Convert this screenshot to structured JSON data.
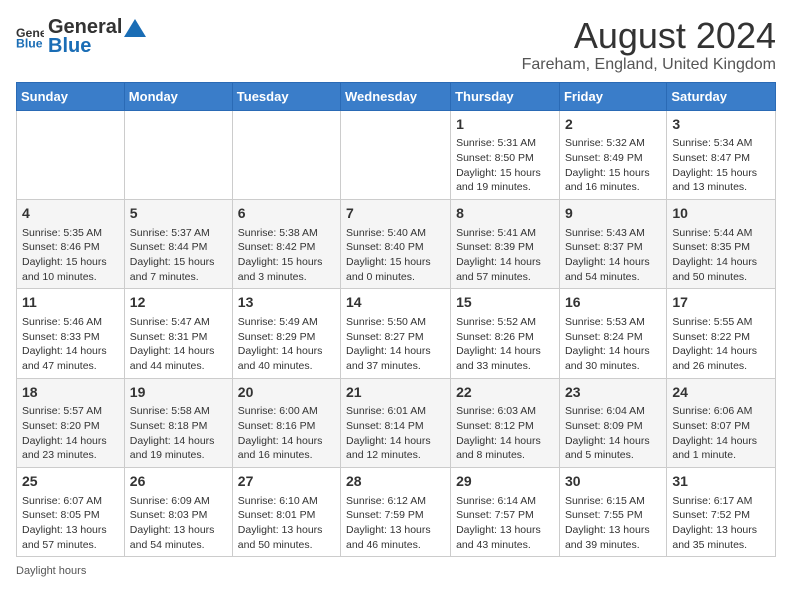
{
  "header": {
    "logo_general": "General",
    "logo_blue": "Blue",
    "title": "August 2024",
    "subtitle": "Fareham, England, United Kingdom"
  },
  "columns": [
    "Sunday",
    "Monday",
    "Tuesday",
    "Wednesday",
    "Thursday",
    "Friday",
    "Saturday"
  ],
  "weeks": [
    [
      {
        "day": "",
        "info": ""
      },
      {
        "day": "",
        "info": ""
      },
      {
        "day": "",
        "info": ""
      },
      {
        "day": "",
        "info": ""
      },
      {
        "day": "1",
        "info": "Sunrise: 5:31 AM\nSunset: 8:50 PM\nDaylight: 15 hours and 19 minutes."
      },
      {
        "day": "2",
        "info": "Sunrise: 5:32 AM\nSunset: 8:49 PM\nDaylight: 15 hours and 16 minutes."
      },
      {
        "day": "3",
        "info": "Sunrise: 5:34 AM\nSunset: 8:47 PM\nDaylight: 15 hours and 13 minutes."
      }
    ],
    [
      {
        "day": "4",
        "info": "Sunrise: 5:35 AM\nSunset: 8:46 PM\nDaylight: 15 hours and 10 minutes."
      },
      {
        "day": "5",
        "info": "Sunrise: 5:37 AM\nSunset: 8:44 PM\nDaylight: 15 hours and 7 minutes."
      },
      {
        "day": "6",
        "info": "Sunrise: 5:38 AM\nSunset: 8:42 PM\nDaylight: 15 hours and 3 minutes."
      },
      {
        "day": "7",
        "info": "Sunrise: 5:40 AM\nSunset: 8:40 PM\nDaylight: 15 hours and 0 minutes."
      },
      {
        "day": "8",
        "info": "Sunrise: 5:41 AM\nSunset: 8:39 PM\nDaylight: 14 hours and 57 minutes."
      },
      {
        "day": "9",
        "info": "Sunrise: 5:43 AM\nSunset: 8:37 PM\nDaylight: 14 hours and 54 minutes."
      },
      {
        "day": "10",
        "info": "Sunrise: 5:44 AM\nSunset: 8:35 PM\nDaylight: 14 hours and 50 minutes."
      }
    ],
    [
      {
        "day": "11",
        "info": "Sunrise: 5:46 AM\nSunset: 8:33 PM\nDaylight: 14 hours and 47 minutes."
      },
      {
        "day": "12",
        "info": "Sunrise: 5:47 AM\nSunset: 8:31 PM\nDaylight: 14 hours and 44 minutes."
      },
      {
        "day": "13",
        "info": "Sunrise: 5:49 AM\nSunset: 8:29 PM\nDaylight: 14 hours and 40 minutes."
      },
      {
        "day": "14",
        "info": "Sunrise: 5:50 AM\nSunset: 8:27 PM\nDaylight: 14 hours and 37 minutes."
      },
      {
        "day": "15",
        "info": "Sunrise: 5:52 AM\nSunset: 8:26 PM\nDaylight: 14 hours and 33 minutes."
      },
      {
        "day": "16",
        "info": "Sunrise: 5:53 AM\nSunset: 8:24 PM\nDaylight: 14 hours and 30 minutes."
      },
      {
        "day": "17",
        "info": "Sunrise: 5:55 AM\nSunset: 8:22 PM\nDaylight: 14 hours and 26 minutes."
      }
    ],
    [
      {
        "day": "18",
        "info": "Sunrise: 5:57 AM\nSunset: 8:20 PM\nDaylight: 14 hours and 23 minutes."
      },
      {
        "day": "19",
        "info": "Sunrise: 5:58 AM\nSunset: 8:18 PM\nDaylight: 14 hours and 19 minutes."
      },
      {
        "day": "20",
        "info": "Sunrise: 6:00 AM\nSunset: 8:16 PM\nDaylight: 14 hours and 16 minutes."
      },
      {
        "day": "21",
        "info": "Sunrise: 6:01 AM\nSunset: 8:14 PM\nDaylight: 14 hours and 12 minutes."
      },
      {
        "day": "22",
        "info": "Sunrise: 6:03 AM\nSunset: 8:12 PM\nDaylight: 14 hours and 8 minutes."
      },
      {
        "day": "23",
        "info": "Sunrise: 6:04 AM\nSunset: 8:09 PM\nDaylight: 14 hours and 5 minutes."
      },
      {
        "day": "24",
        "info": "Sunrise: 6:06 AM\nSunset: 8:07 PM\nDaylight: 14 hours and 1 minute."
      }
    ],
    [
      {
        "day": "25",
        "info": "Sunrise: 6:07 AM\nSunset: 8:05 PM\nDaylight: 13 hours and 57 minutes."
      },
      {
        "day": "26",
        "info": "Sunrise: 6:09 AM\nSunset: 8:03 PM\nDaylight: 13 hours and 54 minutes."
      },
      {
        "day": "27",
        "info": "Sunrise: 6:10 AM\nSunset: 8:01 PM\nDaylight: 13 hours and 50 minutes."
      },
      {
        "day": "28",
        "info": "Sunrise: 6:12 AM\nSunset: 7:59 PM\nDaylight: 13 hours and 46 minutes."
      },
      {
        "day": "29",
        "info": "Sunrise: 6:14 AM\nSunset: 7:57 PM\nDaylight: 13 hours and 43 minutes."
      },
      {
        "day": "30",
        "info": "Sunrise: 6:15 AM\nSunset: 7:55 PM\nDaylight: 13 hours and 39 minutes."
      },
      {
        "day": "31",
        "info": "Sunrise: 6:17 AM\nSunset: 7:52 PM\nDaylight: 13 hours and 35 minutes."
      }
    ]
  ],
  "footer": {
    "daylight_label": "Daylight hours"
  }
}
